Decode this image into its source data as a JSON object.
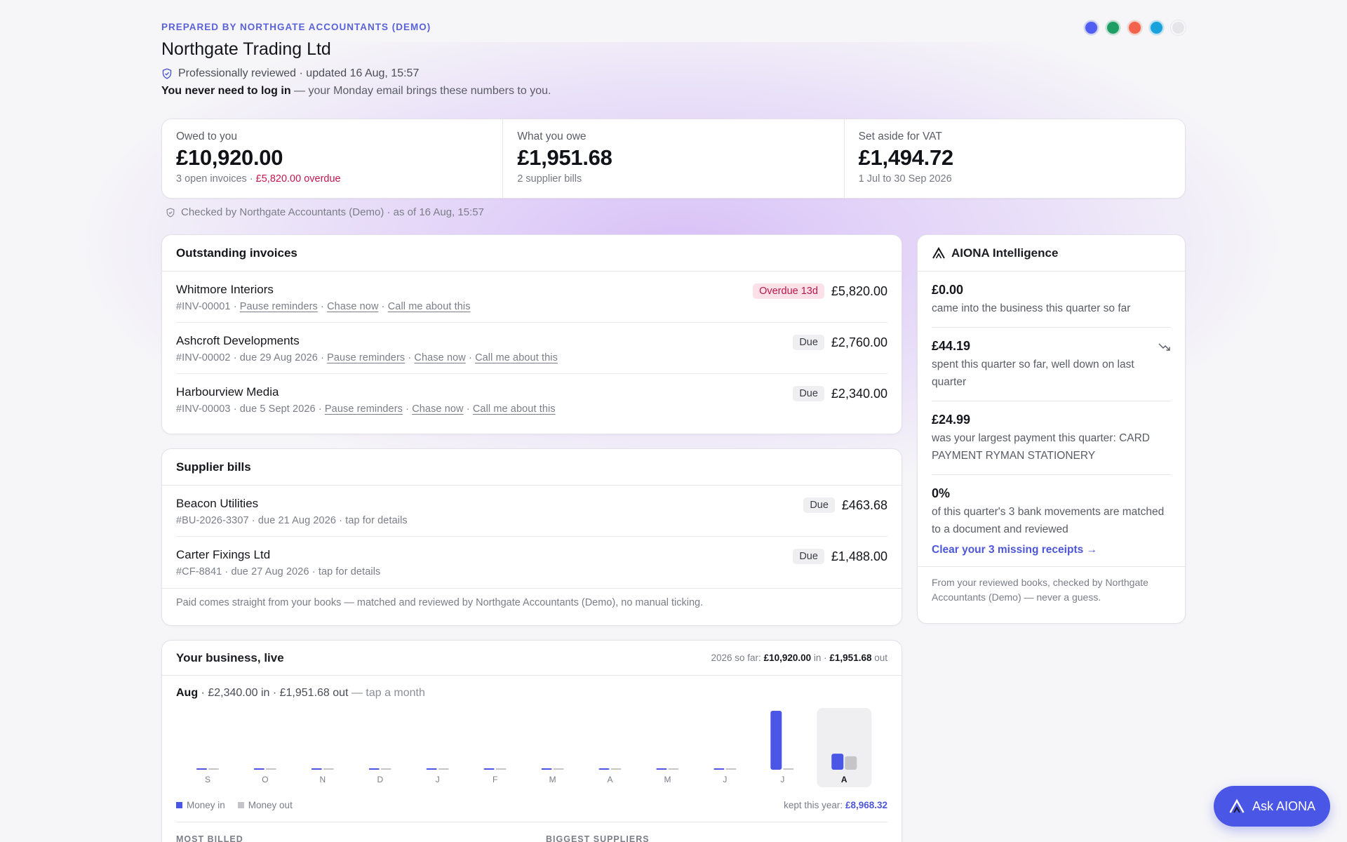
{
  "header": {
    "prepared_by": "PREPARED BY NORTHGATE ACCOUNTANTS (DEMO)",
    "company": "Northgate Trading Ltd",
    "reviewed": "Professionally reviewed · updated 16 Aug, 15:57",
    "never_bold": "You never need to log in",
    "never_rest": " — your Monday email brings these numbers to you.",
    "theme_colors": [
      "#4f5ef0",
      "#1f9e63",
      "#f2624c",
      "#1aa2dc",
      "#e6e6ea"
    ]
  },
  "summary": {
    "owed": {
      "label": "Owed to you",
      "value": "£10,920.00",
      "sub": "3 open invoices · ",
      "sub_alert": "£5,820.00 overdue"
    },
    "owe": {
      "label": "What you owe",
      "value": "£1,951.68",
      "sub": "2 supplier bills"
    },
    "vat": {
      "label": "Set aside for VAT",
      "value": "£1,494.72",
      "sub": "1 Jul to 30 Sep 2026"
    },
    "checked": "Checked by Northgate Accountants (Demo) · as of 16 Aug, 15:57"
  },
  "invoices": {
    "title": "Outstanding invoices",
    "link_labels": {
      "pause": "Pause reminders",
      "chase": "Chase now",
      "call": "Call me about this"
    },
    "rows": [
      {
        "name": "Whitmore Interiors",
        "ref": "#INV-00001 · ",
        "badge": "Overdue 13d",
        "amount": "£5,820.00"
      },
      {
        "name": "Ashcroft Developments",
        "ref": "#INV-00002 · due 29 Aug 2026 · ",
        "badge": "Due",
        "amount": "£2,760.00"
      },
      {
        "name": "Harbourview Media",
        "ref": "#INV-00003 · due 5 Sept 2026 · ",
        "badge": "Due",
        "amount": "£2,340.00"
      }
    ]
  },
  "bills": {
    "title": "Supplier bills",
    "rows": [
      {
        "name": "Beacon Utilities",
        "ref": "#BU-2026-3307 · due 21 Aug 2026 · tap for details",
        "badge": "Due",
        "amount": "£463.68"
      },
      {
        "name": "Carter Fixings Ltd",
        "ref": "#CF-8841 · due 27 Aug 2026 · tap for details",
        "badge": "Due",
        "amount": "£1,488.00"
      }
    ],
    "note": "Paid comes straight from your books — matched and reviewed by Northgate Accountants (Demo), no manual ticking."
  },
  "aiona": {
    "title": "AIONA Intelligence",
    "items": [
      {
        "value": "£0.00",
        "text": "came into the business this quarter so far"
      },
      {
        "value": "£44.19",
        "text": "spent this quarter so far, well down on last quarter",
        "trend": "trending-down-icon"
      },
      {
        "value": "£24.99",
        "text": "was your largest payment this quarter: CARD PAYMENT RYMAN STATIONERY"
      },
      {
        "value": "0%",
        "text": "of this quarter's 3 bank movements are matched to a document and reviewed",
        "link": "Clear your 3 missing receipts →"
      }
    ],
    "footer": "From your reviewed books, checked by Northgate Accountants (Demo) — never a guess."
  },
  "live": {
    "title": "Your business, live",
    "so_far_prefix": "2026 so far: ",
    "so_far_in": "£10,920.00",
    "so_far_mid": " in · ",
    "so_far_out": "£1,951.68",
    "so_far_suffix": " out",
    "selected_month": "Aug",
    "selected_detail": " · £2,340.00 in · £1,951.68 out",
    "selected_hint": " — tap a month",
    "legend_in": "Money in",
    "legend_out": "Money out",
    "kept_label": "kept this year: ",
    "kept_value": "£8,968.32",
    "most_billed": "MOST BILLED",
    "biggest_suppliers": "BIGGEST SUPPLIERS"
  },
  "chart_data": {
    "type": "bar",
    "categories": [
      "S",
      "O",
      "N",
      "D",
      "J",
      "F",
      "M",
      "A",
      "M",
      "J",
      "J",
      "A"
    ],
    "series": [
      {
        "name": "Money in",
        "color": "#4a56e6",
        "values": [
          0,
          0,
          0,
          0,
          0,
          0,
          0,
          0,
          0,
          0,
          8580,
          2340
        ]
      },
      {
        "name": "Money out",
        "color": "#c4c4c9",
        "values": [
          0,
          0,
          0,
          0,
          0,
          0,
          0,
          0,
          0,
          0,
          0,
          1951.68
        ]
      }
    ],
    "selected_index": 11,
    "ylim": [
      0,
      8580
    ]
  },
  "ask": {
    "label": "Ask AIONA"
  }
}
